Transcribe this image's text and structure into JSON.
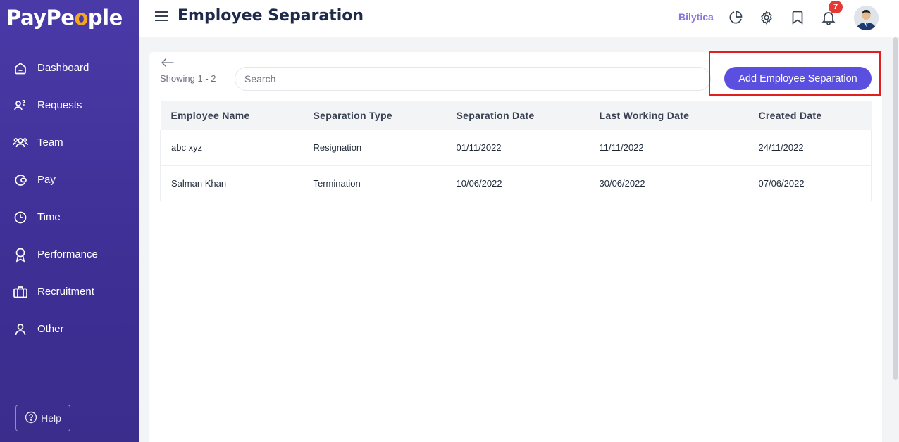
{
  "app": {
    "logo_prefix": "PayPe",
    "logo_accent": "o",
    "logo_suffix": "ple"
  },
  "sidebar": {
    "items": [
      {
        "label": "Dashboard",
        "icon": "home-icon"
      },
      {
        "label": "Requests",
        "icon": "requests-icon"
      },
      {
        "label": "Team",
        "icon": "team-icon"
      },
      {
        "label": "Pay",
        "icon": "wallet-icon"
      },
      {
        "label": "Time",
        "icon": "clock-icon"
      },
      {
        "label": "Performance",
        "icon": "award-icon"
      },
      {
        "label": "Recruitment",
        "icon": "briefcase-icon"
      },
      {
        "label": "Other",
        "icon": "user-icon"
      }
    ],
    "help_label": "Help"
  },
  "header": {
    "title": "Employee Separation",
    "company": "Bilytica",
    "notification_count": "7"
  },
  "toolbar": {
    "showing": "Showing 1 - 2",
    "search_placeholder": "Search",
    "add_button": "Add Employee Separation"
  },
  "table": {
    "columns": [
      "Employee Name",
      "Separation Type",
      "Separation Date",
      "Last Working Date",
      "Created Date"
    ],
    "rows": [
      [
        "abc xyz",
        "Resignation",
        "01/11/2022",
        "11/11/2022",
        "24/11/2022"
      ],
      [
        "Salman Khan",
        "Termination",
        "10/06/2022",
        "30/06/2022",
        "07/06/2022"
      ]
    ]
  },
  "colors": {
    "sidebar": "#4a3aa8",
    "accent": "#5b4fe0",
    "highlight": "#e02020",
    "badge": "#e53935"
  }
}
